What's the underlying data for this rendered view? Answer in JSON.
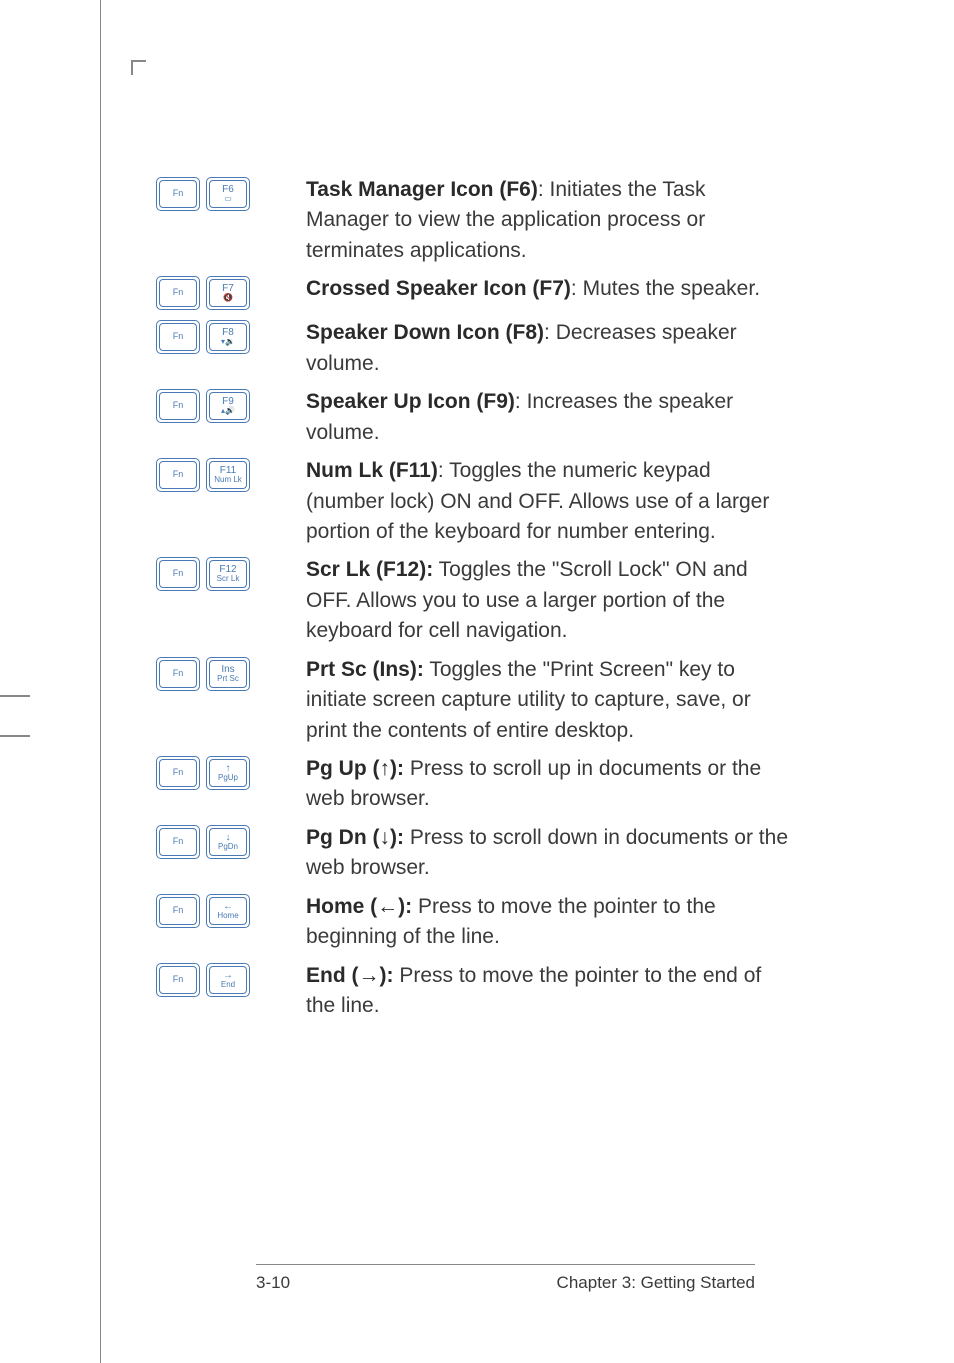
{
  "items": [
    {
      "fn": "Fn",
      "key_top": "F6",
      "key_bot": "▭",
      "bold": "Task Manager Icon (F6)",
      "sep": ": ",
      "text": "Initiates the Task Manager to view the application process or terminates applications."
    },
    {
      "fn": "Fn",
      "key_top": "F7",
      "key_bot": "🔇",
      "bold": "Crossed Speaker Icon (F7)",
      "sep": ": ",
      "text": "Mutes the speaker."
    },
    {
      "fn": "Fn",
      "key_top": "F8",
      "key_bot": "▾🔉",
      "bold": "Speaker Down Icon (F8)",
      "sep": ": ",
      "text": "Decreases speaker volume."
    },
    {
      "fn": "Fn",
      "key_top": "F9",
      "key_bot": "▴🔊",
      "bold": "Speaker Up Icon (F9)",
      "sep": ": ",
      "text": "Increases the speaker volume."
    },
    {
      "fn": "Fn",
      "key_top": "F11",
      "key_bot": "Num Lk",
      "bold": "Num Lk (F11)",
      "sep": ": ",
      "text": "Toggles the numeric keypad (number lock) ON and OFF. Allows use of a larger portion of the keyboard for number entering."
    },
    {
      "fn": "Fn",
      "key_top": "F12",
      "key_bot": "Scr Lk",
      "bold": "Scr Lk (F12):",
      "sep": " ",
      "text": "Toggles the \"Scroll Lock\" ON and OFF. Allows you to use a larger portion of the keyboard for cell navigation."
    },
    {
      "fn": "Fn",
      "key_top": "Ins",
      "key_bot": "Prt Sc",
      "bold": "Prt Sc (Ins):",
      "sep": " ",
      "text": "Toggles the \"Print Screen\" key to initiate screen capture utility to capture, save, or print the contents of entire desktop."
    },
    {
      "fn": "Fn",
      "key_top": "↑",
      "key_bot": "PgUp",
      "bold": "Pg Up (↑):",
      "sep": " ",
      "text": "Press to scroll up in documents or the web browser."
    },
    {
      "fn": "Fn",
      "key_top": "↓",
      "key_bot": "PgDn",
      "bold": "Pg Dn (↓):",
      "sep": " ",
      "text": "Press to scroll down in documents or the web browser."
    },
    {
      "fn": "Fn",
      "key_top": "←",
      "key_bot": "Home",
      "bold": "Home (←):",
      "sep": " ",
      "text": "Press to move the pointer to the beginning of the line."
    },
    {
      "fn": "Fn",
      "key_top": "→",
      "key_bot": "End",
      "bold": "End (→):",
      "sep": " ",
      "text": "Press to move the pointer to the end of the line."
    }
  ],
  "footer": {
    "left": "3-10",
    "right": "Chapter 3: Getting Started"
  }
}
